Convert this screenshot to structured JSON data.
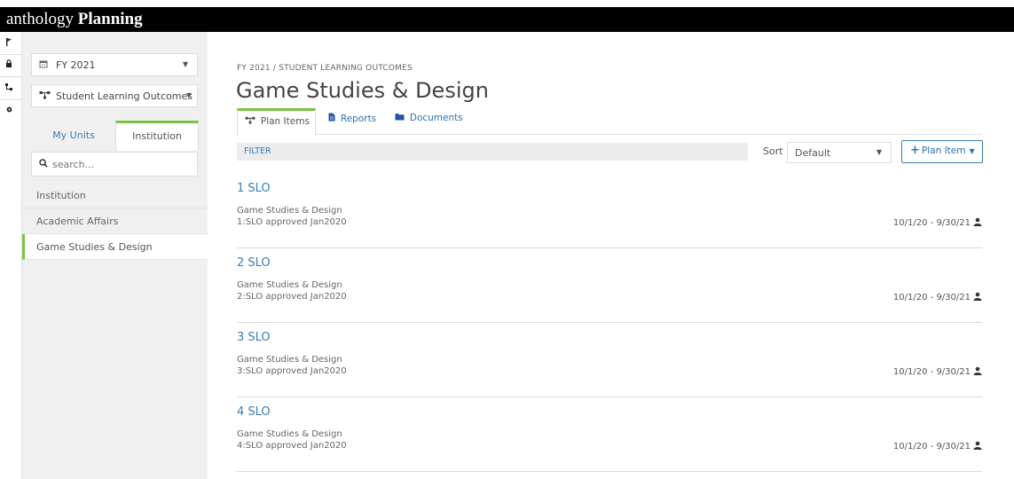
{
  "app": {
    "brand_light": "anthology",
    "brand_bold": "Planning"
  },
  "rail": {
    "icons": [
      "flag-icon",
      "lock-icon",
      "hierarchy-icon",
      "gear-icon"
    ]
  },
  "sidebar": {
    "year_select": "FY 2021",
    "plan_type_select": "Student Learning Outcomes",
    "tabs": [
      {
        "label": "My Units"
      },
      {
        "label": "Institution"
      }
    ],
    "search_placeholder": "search...",
    "tree": [
      {
        "label": "Institution"
      },
      {
        "label": "Academic Affairs"
      },
      {
        "label": "Game Studies & Design"
      }
    ]
  },
  "main": {
    "breadcrumb": "FY 2021 / STUDENT LEARNING OUTCOMES",
    "title": "Game Studies & Design",
    "tabs": [
      {
        "label": "Plan Items"
      },
      {
        "label": "Reports"
      },
      {
        "label": "Documents"
      }
    ],
    "filter_label": "FILTER",
    "sort_label": "Sort",
    "sort_value": "Default",
    "add_button": "Plan Item",
    "items": [
      {
        "name": "1 SLO",
        "unit": "Game Studies & Design",
        "desc": "1:SLO approved Jan2020",
        "dates": "10/1/20 - 9/30/21"
      },
      {
        "name": "2 SLO",
        "unit": "Game Studies & Design",
        "desc": "2:SLO approved Jan2020",
        "dates": "10/1/20 - 9/30/21"
      },
      {
        "name": "3 SLO",
        "unit": "Game Studies & Design",
        "desc": "3:SLO approved Jan2020",
        "dates": "10/1/20 - 9/30/21"
      },
      {
        "name": "4 SLO",
        "unit": "Game Studies & Design",
        "desc": "4:SLO approved Jan2020",
        "dates": "10/1/20 - 9/30/21"
      }
    ]
  },
  "colors": {
    "accent_green": "#7cc243",
    "link_blue": "#3a7fb7",
    "topbar": "#000000"
  }
}
